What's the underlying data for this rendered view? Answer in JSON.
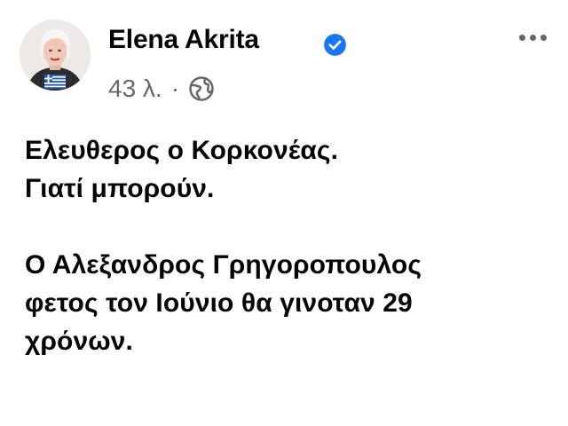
{
  "author": {
    "name": "Elena Akrita",
    "verified": true
  },
  "meta": {
    "time": "43 λ.",
    "separator": "·",
    "audience_icon": "globe-icon"
  },
  "post": {
    "paragraph1": {
      "line1": "Ελευθερος ο Κορκονέας.",
      "line2": "Γιατί μπορούν."
    },
    "paragraph2": {
      "line1": "Ο Αλεξανδρος Γρηγοροπουλος",
      "line2": "φετος τον Ιούνιο θα γινοταν 29",
      "line3": "χρόνων."
    }
  },
  "icons": {
    "more": "more-horizontal-icon",
    "verified": "verified-badge-icon"
  },
  "colors": {
    "text": "#050505",
    "secondary": "#65676b",
    "verified_blue": "#1877f2",
    "background": "#ffffff"
  }
}
